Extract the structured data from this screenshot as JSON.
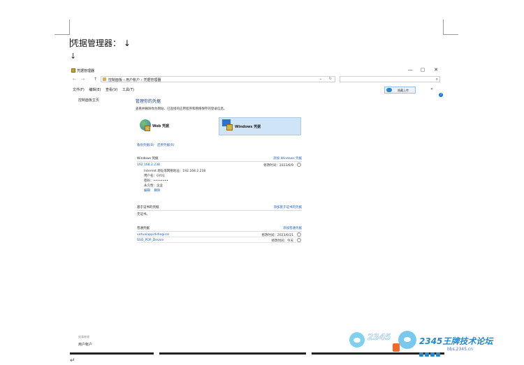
{
  "document": {
    "heading": "凭据管理器：",
    "heading_arrow": "↓",
    "para_mark": "↓",
    "para_mark_bottom": "↵"
  },
  "window": {
    "title": "凭据管理器",
    "controls": [
      "—",
      "▢",
      "✕"
    ],
    "nav": [
      "←",
      "→",
      "↑"
    ],
    "path": "控制面板  ›  用户帐户  ›  凭据管理器",
    "search_placeholder": "",
    "menu": [
      "文件(F)",
      "编辑(E)",
      "查看(V)",
      "工具(T)"
    ],
    "upload_label": "隐藏上传",
    "sidebar": {
      "home": "控制面板主页",
      "see_also": "另请参阅",
      "user_accounts": "用户帐户"
    },
    "main": {
      "heading": "管理你的凭据",
      "description": "查看并删除你为网站、已连接的应用程序和网络保存的登录信息。",
      "tabs": [
        {
          "label": "Web 凭据"
        },
        {
          "label": "Windows 凭据"
        }
      ],
      "links": [
        "备份凭据(B)",
        "还原凭据(R)"
      ],
      "windows_section": {
        "title": "Windows 凭据",
        "add": "添加 Windows 凭据",
        "entry": {
          "name": "192.168.2.238",
          "modified": "修改时间：2023/6/9",
          "details": [
            "Internet 地址或网络地址：192.168.2.238",
            "用户名：GY01",
            "密码：••••••••",
            "永久性：企业"
          ],
          "actions": [
            "编辑",
            "删除"
          ]
        }
      },
      "cert_section": {
        "title": "基于证书的凭据",
        "add": "添加基于证书的凭据",
        "empty": "无证书。"
      },
      "generic_section": {
        "title": "普通凭据",
        "add": "添加普通凭据",
        "rows": [
          {
            "name": "virtualapp/didlogical",
            "modified": "修改时间：2023/6/21"
          },
          {
            "name": "SSO_POP_Device",
            "modified": "修改时间：今天"
          }
        ]
      }
    }
  },
  "watermark": {
    "text1": "2345",
    "text2": "2345王牌技术论坛",
    "url": "bbs.2345.cn"
  }
}
